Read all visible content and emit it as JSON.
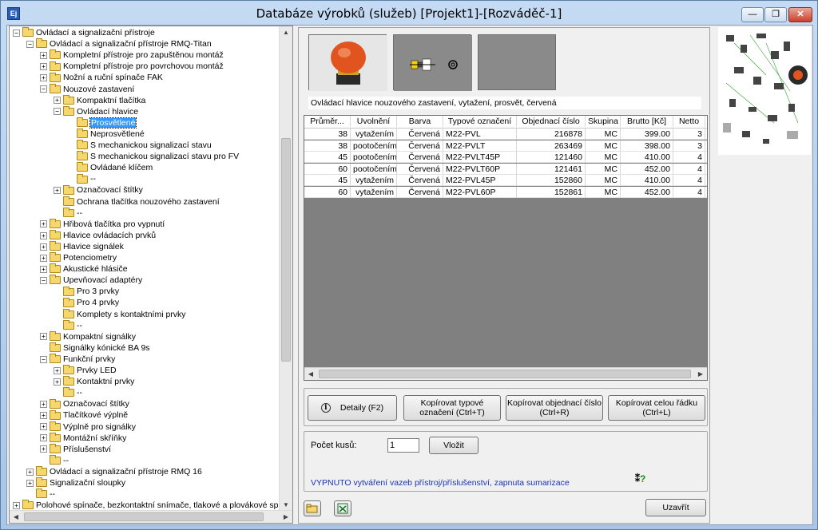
{
  "window": {
    "title": "Databáze výrobků (služeb) [Projekt1]-[Rozváděč-1]",
    "app_icon": "Ej",
    "min_label": "—",
    "max_label": "❐",
    "close_label": "✕"
  },
  "tree": {
    "items": [
      {
        "level": 0,
        "exp": "−",
        "label": "Ovládací a signalizační přístroje"
      },
      {
        "level": 1,
        "exp": "−",
        "label": "Ovládací a signalizační přístroje RMQ-Titan"
      },
      {
        "level": 2,
        "exp": "+",
        "label": "Kompletní přístroje pro zapuštěnou montáž"
      },
      {
        "level": 2,
        "exp": "+",
        "label": "Kompletní přístroje pro povrchovou montáž"
      },
      {
        "level": 2,
        "exp": "+",
        "label": "Nožní a ruční spínače FAK"
      },
      {
        "level": 2,
        "exp": "−",
        "label": "Nouzové zastavení"
      },
      {
        "level": 3,
        "exp": "+",
        "label": "Kompaktní tlačítka"
      },
      {
        "level": 3,
        "exp": "−",
        "label": "Ovládací hlavice"
      },
      {
        "level": 4,
        "exp": "",
        "label": "Prosvětlené",
        "selected": true
      },
      {
        "level": 4,
        "exp": "",
        "label": "Neprosvětlené"
      },
      {
        "level": 4,
        "exp": "",
        "label": "S mechanickou signalizací stavu"
      },
      {
        "level": 4,
        "exp": "",
        "label": "S mechanickou signalizací stavu pro FV"
      },
      {
        "level": 4,
        "exp": "",
        "label": "Ovládané klíčem"
      },
      {
        "level": 4,
        "exp": "",
        "label": "--"
      },
      {
        "level": 3,
        "exp": "+",
        "label": "Označovací štítky"
      },
      {
        "level": 3,
        "exp": "",
        "label": "Ochrana tlačítka nouzového zastavení"
      },
      {
        "level": 3,
        "exp": "",
        "label": "--"
      },
      {
        "level": 2,
        "exp": "+",
        "label": "Hřibová tlačítka pro vypnutí"
      },
      {
        "level": 2,
        "exp": "+",
        "label": "Hlavice ovládacích prvků"
      },
      {
        "level": 2,
        "exp": "+",
        "label": "Hlavice signálek"
      },
      {
        "level": 2,
        "exp": "+",
        "label": "Potenciometry"
      },
      {
        "level": 2,
        "exp": "+",
        "label": "Akustické hlásiče"
      },
      {
        "level": 2,
        "exp": "−",
        "label": "Upevňovací adaptéry"
      },
      {
        "level": 3,
        "exp": "",
        "label": "Pro 3 prvky"
      },
      {
        "level": 3,
        "exp": "",
        "label": "Pro 4 prvky"
      },
      {
        "level": 3,
        "exp": "",
        "label": "Komplety s kontaktními prvky"
      },
      {
        "level": 3,
        "exp": "",
        "label": "--"
      },
      {
        "level": 2,
        "exp": "+",
        "label": "Kompaktní signálky"
      },
      {
        "level": 2,
        "exp": "",
        "label": "Signálky kónické BA 9s"
      },
      {
        "level": 2,
        "exp": "−",
        "label": "Funkční prvky"
      },
      {
        "level": 3,
        "exp": "+",
        "label": "Prvky LED"
      },
      {
        "level": 3,
        "exp": "+",
        "label": "Kontaktní prvky"
      },
      {
        "level": 3,
        "exp": "",
        "label": "--"
      },
      {
        "level": 2,
        "exp": "+",
        "label": "Označovací štítky"
      },
      {
        "level": 2,
        "exp": "+",
        "label": "Tlačítkové výplně"
      },
      {
        "level": 2,
        "exp": "+",
        "label": "Výplně pro signálky"
      },
      {
        "level": 2,
        "exp": "+",
        "label": "Montážní skříňky"
      },
      {
        "level": 2,
        "exp": "+",
        "label": "Příslušenství"
      },
      {
        "level": 2,
        "exp": "",
        "label": "--"
      },
      {
        "level": 1,
        "exp": "+",
        "label": "Ovládací a signalizační přístroje RMQ 16"
      },
      {
        "level": 1,
        "exp": "+",
        "label": "Signalizační sloupky"
      },
      {
        "level": 1,
        "exp": "",
        "label": "--"
      },
      {
        "level": 0,
        "exp": "+",
        "label": "Polohové spínače, bezkontaktní snímače, tlakové a plovákové spínače"
      }
    ]
  },
  "product": {
    "description": "Ovládací hlavice nouzového zastavení, vytažení, prosvět, červená"
  },
  "grid": {
    "columns": [
      "Průměr...",
      "Uvolnění",
      "Barva",
      "Typové označení",
      "Objednací číslo",
      "Skupina",
      "Brutto [Kč]",
      "Netto"
    ],
    "rows": [
      [
        "38",
        "vytažením",
        "Červená",
        "M22-PVL",
        "216878",
        "MC",
        "399.00",
        "3"
      ],
      [
        "38",
        "pootočením",
        "Červená",
        "M22-PVLT",
        "263469",
        "MC",
        "398.00",
        "3"
      ],
      [
        "45",
        "pootočením",
        "Červená",
        "M22-PVLT45P",
        "121460",
        "MC",
        "410.00",
        "4"
      ],
      [
        "60",
        "pootočením",
        "Červená",
        "M22-PVLT60P",
        "121461",
        "MC",
        "452.00",
        "4"
      ],
      [
        "45",
        "vytažením",
        "Červená",
        "M22-PVL45P",
        "152860",
        "MC",
        "410.00",
        "4"
      ],
      [
        "60",
        "vytažením",
        "Červená",
        "M22-PVL60P",
        "152861",
        "MC",
        "452.00",
        "4"
      ]
    ]
  },
  "buttons": {
    "details": "Detaily (F2)",
    "copy_type": "Kopírovat typové označení (Ctrl+T)",
    "copy_order": "Kopírovat objednací číslo (Ctrl+R)",
    "copy_row": "Kopírovat celou řádku (Ctrl+L)",
    "insert": "Vložit",
    "close": "Uzavřít"
  },
  "quantity": {
    "label": "Počet kusů:",
    "value": "1"
  },
  "status": {
    "text": "VYPNUTO vytváření vazeb přístroj/příslušenství, zapnuta sumarizace",
    "help_icon": "help-icon"
  }
}
